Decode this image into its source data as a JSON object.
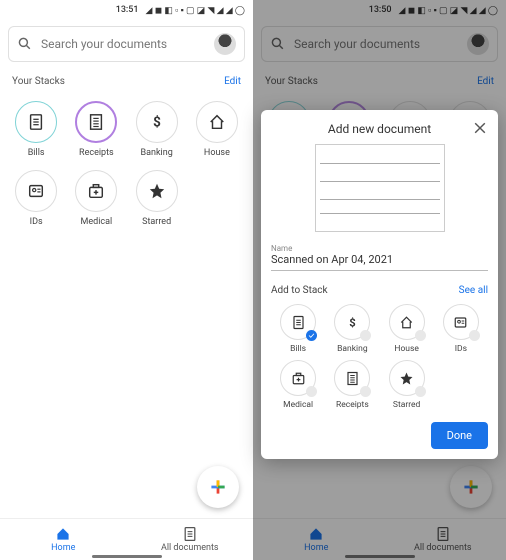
{
  "left": {
    "statusbar": {
      "time": "13:51"
    },
    "search": {
      "placeholder": "Search your documents"
    },
    "stacks": {
      "header": "Your Stacks",
      "edit": "Edit",
      "items": [
        {
          "label": "Bills",
          "ring": "#7fd3d6"
        },
        {
          "label": "Receipts",
          "ring": "#b07fe0"
        },
        {
          "label": "Banking",
          "ring": "#ddd"
        },
        {
          "label": "House",
          "ring": "#ddd"
        },
        {
          "label": "IDs",
          "ring": "#ddd"
        },
        {
          "label": "Medical",
          "ring": "#ddd"
        },
        {
          "label": "Starred",
          "ring": "#ddd"
        }
      ]
    },
    "nav": {
      "home": "Home",
      "all": "All documents"
    }
  },
  "right": {
    "statusbar": {
      "time": "13:50"
    },
    "search": {
      "placeholder": "Search your documents"
    },
    "stacks": {
      "header": "Your Stacks",
      "edit": "Edit"
    },
    "sheet": {
      "title": "Add new document",
      "name_label": "Name",
      "name_value": "Scanned on Apr 04, 2021",
      "add_header": "Add to Stack",
      "see_all": "See all",
      "items": [
        {
          "label": "Bills",
          "selected": true
        },
        {
          "label": "Banking",
          "selected": false
        },
        {
          "label": "House",
          "selected": false
        },
        {
          "label": "IDs",
          "selected": false
        },
        {
          "label": "Medical",
          "selected": false
        },
        {
          "label": "Receipts",
          "selected": false
        },
        {
          "label": "Starred",
          "selected": false
        }
      ],
      "done": "Done"
    },
    "nav": {
      "home": "Home",
      "all": "All documents"
    }
  }
}
